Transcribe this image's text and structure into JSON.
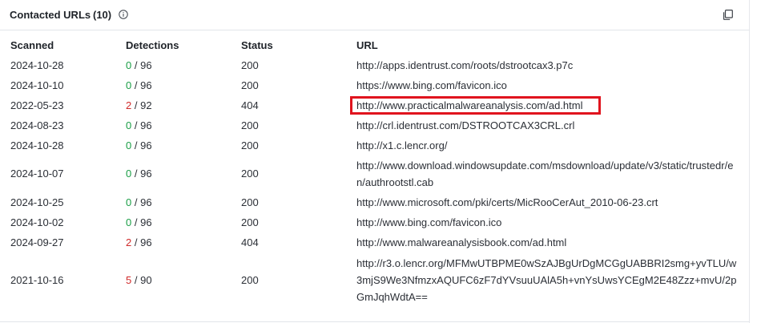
{
  "header": {
    "title": "Contacted URLs",
    "count": "(10)",
    "info_icon": "info-circle-icon",
    "copy_icon": "copy-icon"
  },
  "columns": {
    "scanned": "Scanned",
    "detections": "Detections",
    "status": "Status",
    "url": "URL"
  },
  "rows": [
    {
      "scanned": "2024-10-28",
      "det": "0",
      "total": "/ 96",
      "status": "200",
      "url": "http://apps.identrust.com/roots/dstrootcax3.p7c"
    },
    {
      "scanned": "2024-10-10",
      "det": "0",
      "total": "/ 96",
      "status": "200",
      "url": "https://www.bing.com/favicon.ico"
    },
    {
      "scanned": "2022-05-23",
      "det": "2",
      "total": "/ 92",
      "status": "404",
      "url": "http://www.practicalmalwareanalysis.com/ad.html"
    },
    {
      "scanned": "2024-08-23",
      "det": "0",
      "total": "/ 96",
      "status": "200",
      "url": "http://crl.identrust.com/DSTROOTCAX3CRL.crl"
    },
    {
      "scanned": "2024-10-28",
      "det": "0",
      "total": "/ 96",
      "status": "200",
      "url": "http://x1.c.lencr.org/"
    },
    {
      "scanned": "2024-10-07",
      "det": "0",
      "total": "/ 96",
      "status": "200",
      "url": "http://www.download.windowsupdate.com/msdownload/update/v3/static/trustedr/en/authrootstl.cab"
    },
    {
      "scanned": "2024-10-25",
      "det": "0",
      "total": "/ 96",
      "status": "200",
      "url": "http://www.microsoft.com/pki/certs/MicRooCerAut_2010-06-23.crt"
    },
    {
      "scanned": "2024-10-02",
      "det": "0",
      "total": "/ 96",
      "status": "200",
      "url": "http://www.bing.com/favicon.ico"
    },
    {
      "scanned": "2024-09-27",
      "det": "2",
      "total": "/ 96",
      "status": "404",
      "url": "http://www.malwareanalysisbook.com/ad.html"
    },
    {
      "scanned": "2021-10-16",
      "det": "5",
      "total": "/ 90",
      "status": "200",
      "url": "http://r3.o.lencr.org/MFMwUTBPME0wSzAJBgUrDgMCGgUABBRI2smg+yvTLU/w3mjS9We3NfmzxAQUFC6zF7dYVsuuUAlA5h+vnYsUwsYCEgM2E48Zzz+mvU/2pGmJqhWdtA=="
    }
  ],
  "colors": {
    "clean": "#1a9e46",
    "malicious": "#d02a2a",
    "highlight": "#e0141e"
  }
}
